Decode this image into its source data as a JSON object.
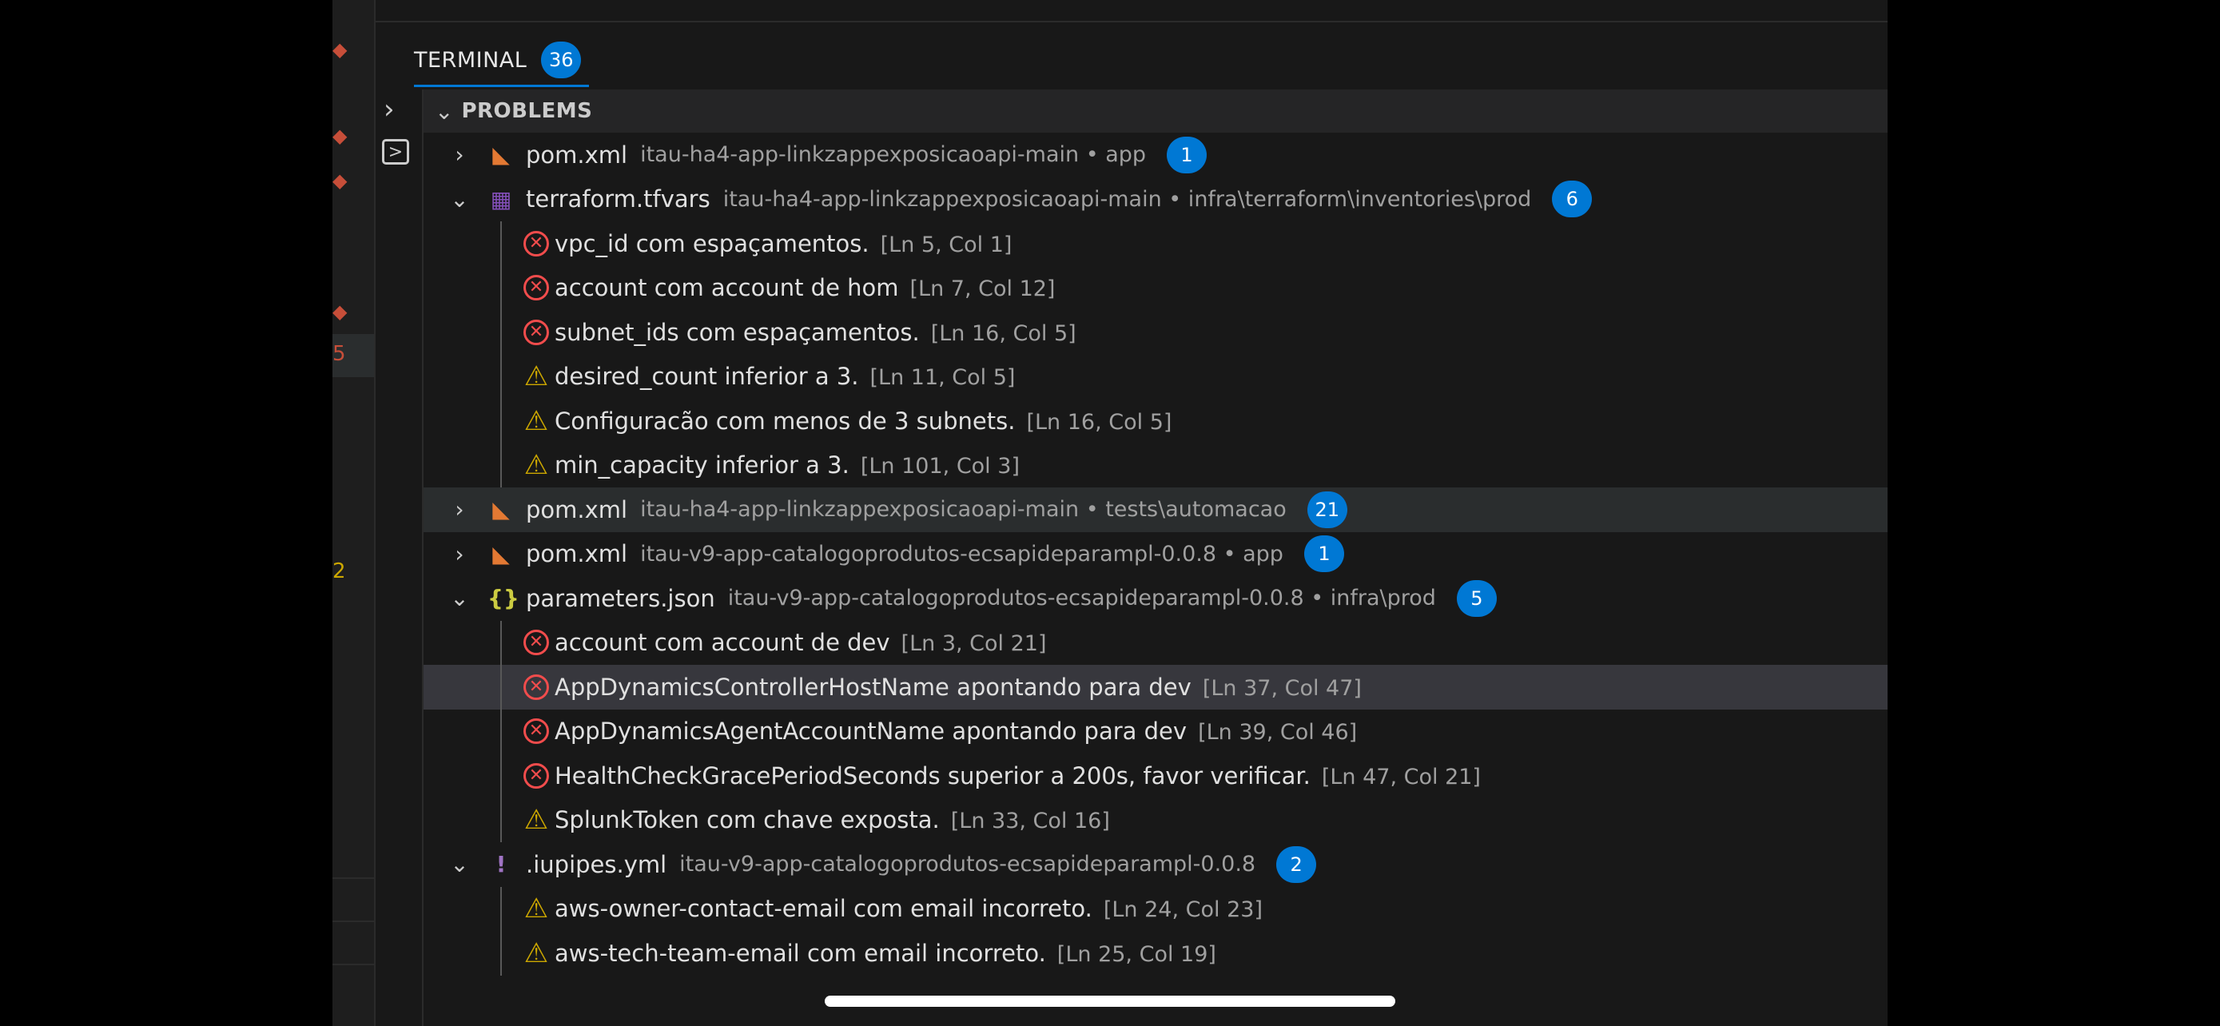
{
  "colors": {
    "badge": "#0078d4",
    "error": "#f14c4c",
    "warning": "#cca700",
    "xml_icon": "#e37933",
    "terraform_icon": "#844fba",
    "json_icon": "#cbcb41",
    "yml_icon": "#a074c4"
  },
  "editor_gutter": {
    "marks": [
      "◆",
      "◆",
      "◆",
      "◆"
    ],
    "num_5": "5",
    "num_2": "2"
  },
  "panel": {
    "tab": {
      "label": "TERMINAL",
      "badge": "36"
    },
    "activity": {
      "chevron": "›",
      "terminal": ">"
    },
    "problems": {
      "title": "PROBLEMS",
      "chevron": "⌄",
      "files": [
        {
          "icon": "rss-icon",
          "glyph": "◣",
          "name": "pom.xml",
          "path": "itau-ha4-app-linkzappexposicaoapi-main • app",
          "badge": "1",
          "expanded": false,
          "issues": []
        },
        {
          "icon": "terraform-icon",
          "glyph": "▦",
          "name": "terraform.tfvars",
          "path": "itau-ha4-app-linkzappexposicaoapi-main • infra\\terraform\\inventories\\prod",
          "badge": "6",
          "expanded": true,
          "issues": [
            {
              "severity": "error",
              "message": "vpc_id com espaçamentos.",
              "location": "[Ln 5, Col 1]"
            },
            {
              "severity": "error",
              "message": "account com account de hom",
              "location": "[Ln 7, Col 12]"
            },
            {
              "severity": "error",
              "message": "subnet_ids com espaçamentos.",
              "location": "[Ln 16, Col 5]"
            },
            {
              "severity": "warning",
              "message": "desired_count inferior a 3.",
              "location": "[Ln 11, Col 5]"
            },
            {
              "severity": "warning",
              "message": "Configuracão com menos de 3 subnets.",
              "location": "[Ln 16, Col 5]"
            },
            {
              "severity": "warning",
              "message": "min_capacity inferior a 3.",
              "location": "[Ln 101, Col 3]"
            }
          ]
        },
        {
          "icon": "rss-icon",
          "glyph": "◣",
          "name": "pom.xml",
          "path": "itau-ha4-app-linkzappexposicaoapi-main • tests\\automacao",
          "badge": "21",
          "expanded": false,
          "issues": []
        },
        {
          "icon": "rss-icon",
          "glyph": "◣",
          "name": "pom.xml",
          "path": "itau-v9-app-catalogoprodutos-ecsapideparampl-0.0.8 • app",
          "badge": "1",
          "expanded": false,
          "issues": []
        },
        {
          "icon": "json-braces-icon",
          "glyph": "{}",
          "name": "parameters.json",
          "path": "itau-v9-app-catalogoprodutos-ecsapideparampl-0.0.8 • infra\\prod",
          "badge": "5",
          "expanded": true,
          "issues": [
            {
              "severity": "error",
              "message": "account com account de dev",
              "location": "[Ln 3, Col 21]"
            },
            {
              "severity": "error",
              "message": "AppDynamicsControllerHostName apontando para dev",
              "location": "[Ln 37, Col 47]"
            },
            {
              "severity": "error",
              "message": "AppDynamicsAgentAccountName apontando para dev",
              "location": "[Ln 39, Col 46]"
            },
            {
              "severity": "error",
              "message": "HealthCheckGracePeriodSeconds superior a 200s, favor verificar.",
              "location": "[Ln 47, Col 21]"
            },
            {
              "severity": "warning",
              "message": "SplunkToken com chave exposta.",
              "location": "[Ln 33, Col 16]"
            }
          ]
        },
        {
          "icon": "exclamation-icon",
          "glyph": "!",
          "name": ".iupipes.yml",
          "path": "itau-v9-app-catalogoprodutos-ecsapideparampl-0.0.8",
          "badge": "2",
          "expanded": true,
          "issues": [
            {
              "severity": "warning",
              "message": "aws-owner-contact-email com email incorreto.",
              "location": "[Ln 24, Col 23]"
            },
            {
              "severity": "warning",
              "message": "aws-tech-team-email com email incorreto.",
              "location": "[Ln 25, Col 19]"
            }
          ]
        }
      ]
    }
  }
}
